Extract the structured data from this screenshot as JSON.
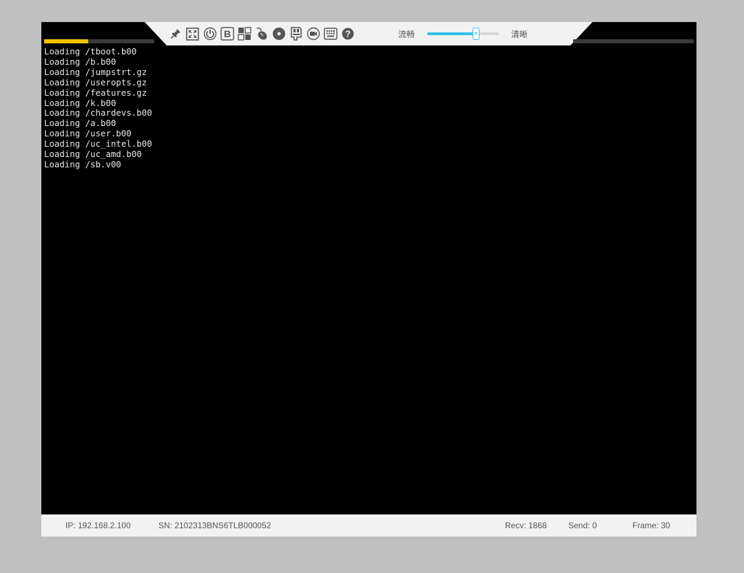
{
  "toolbar": {
    "buffer_progress": 0.4,
    "icons": [
      {
        "name": "pin-icon"
      },
      {
        "name": "fullscreen-icon"
      },
      {
        "name": "power-icon"
      },
      {
        "name": "bold-b-icon",
        "glyph": "B"
      },
      {
        "name": "virtual-media-icon"
      },
      {
        "name": "mouse-icon"
      },
      {
        "name": "disc-icon"
      },
      {
        "name": "floppy-icon"
      },
      {
        "name": "record-icon"
      },
      {
        "name": "keyboard-icon"
      },
      {
        "name": "help-icon",
        "glyph": "?"
      }
    ],
    "quality": {
      "left_label": "流畅",
      "right_label": "清晰",
      "level": 0.68
    }
  },
  "console": {
    "lines": [
      "Loading /tboot.b00",
      "Loading /b.b00",
      "Loading /jumpstrt.gz",
      "Loading /useropts.gz",
      "Loading /features.gz",
      "Loading /k.b00",
      "Loading /chardevs.b00",
      "Loading /a.b00",
      "Loading /user.b00",
      "Loading /uc_intel.b00",
      "Loading /uc_amd.b00",
      "Loading /sb.v00"
    ]
  },
  "status": {
    "ip": "IP: 192.168.2.100",
    "sn": "SN: 2102313BNS6TLB000052",
    "recv": "Recv: 1868",
    "send": "Send: 0",
    "frame": "Frame: 30"
  },
  "colors": {
    "progress": "#f5c000",
    "slider_accent": "#35bfee",
    "console_text": "#e8e8e8",
    "background": "#c0c0c0"
  }
}
